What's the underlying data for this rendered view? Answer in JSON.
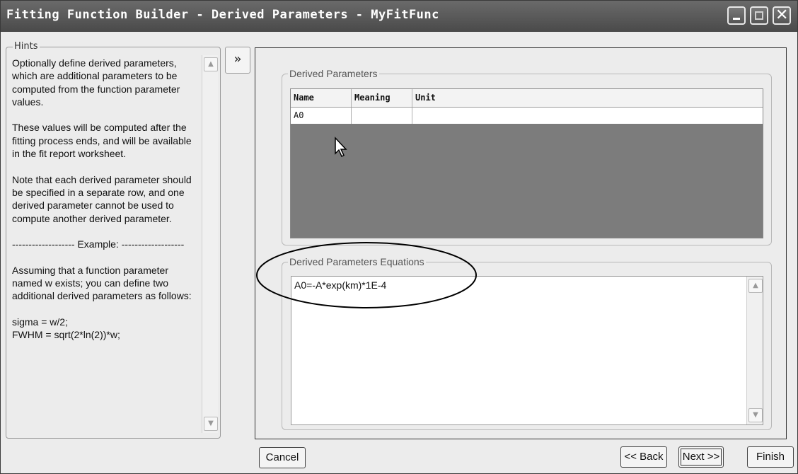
{
  "window": {
    "title": "Fitting Function Builder - Derived Parameters - MyFitFunc",
    "controls": [
      "minimize-icon",
      "maximize-icon",
      "close-icon"
    ]
  },
  "hints": {
    "legend": "Hints",
    "text": "Optionally define derived parameters, which are additional parameters to be computed from the function parameter values.\n\nThese values will be computed after the fitting process ends, and will be available in the fit report worksheet.\n\nNote that each derived parameter should be specified in a separate row, and one derived parameter cannot be used to compute another derived parameter.\n\n------------------- Example: -------------------\n\nAssuming that a function parameter named w exists; you can define two additional derived parameters as follows:\n\nsigma = w/2;\nFWHM = sqrt(2*ln(2))*w;"
  },
  "collapse_button": {
    "label": "»"
  },
  "derived_parameters": {
    "legend": "Derived Parameters",
    "columns": [
      "Name",
      "Meaning",
      "Unit"
    ],
    "rows": [
      {
        "name": "A0",
        "meaning": "",
        "unit": ""
      }
    ]
  },
  "equations": {
    "legend": "Derived Parameters Equations",
    "text": "A0=-A*exp(km)*1E-4"
  },
  "buttons": {
    "cancel": "Cancel",
    "back": "<< Back",
    "next": "Next >>",
    "finish": "Finish"
  }
}
